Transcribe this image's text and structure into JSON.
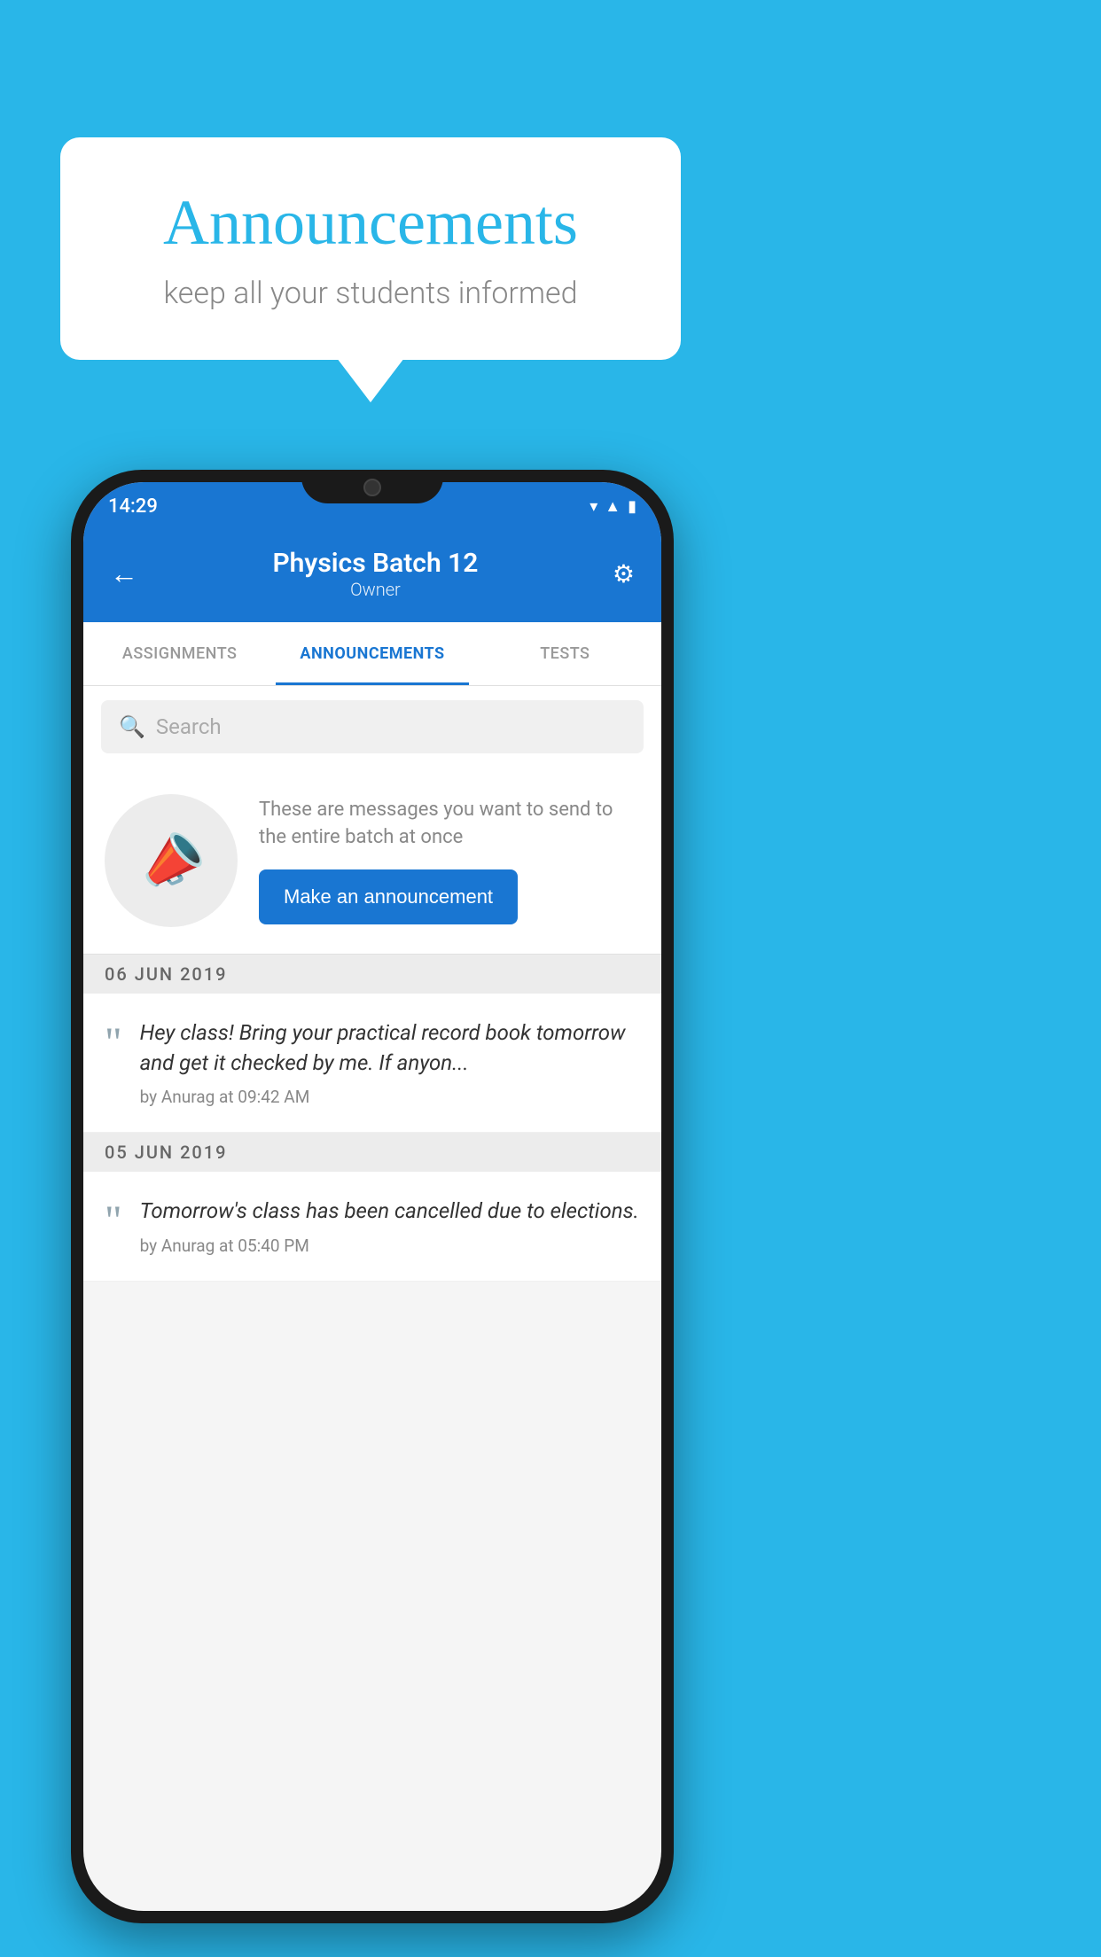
{
  "background_color": "#29b6e8",
  "speech_bubble": {
    "title": "Announcements",
    "subtitle": "keep all your students informed"
  },
  "status_bar": {
    "time": "14:29",
    "icons": [
      "wifi",
      "signal",
      "battery"
    ]
  },
  "header": {
    "title": "Physics Batch 12",
    "subtitle": "Owner",
    "back_label": "←",
    "gear_label": "⚙"
  },
  "tabs": [
    {
      "label": "ASSIGNMENTS",
      "active": false
    },
    {
      "label": "ANNOUNCEMENTS",
      "active": true
    },
    {
      "label": "TESTS",
      "active": false
    },
    {
      "label": "...",
      "active": false
    }
  ],
  "search": {
    "placeholder": "Search"
  },
  "announcement_prompt": {
    "description": "These are messages you want to send to the entire batch at once",
    "button_label": "Make an announcement"
  },
  "date_sections": [
    {
      "date": "06  JUN  2019",
      "items": [
        {
          "message": "Hey class! Bring your practical record book tomorrow and get it checked by me. If anyon...",
          "meta": "by Anurag at 09:42 AM"
        }
      ]
    },
    {
      "date": "05  JUN  2019",
      "items": [
        {
          "message": "Tomorrow's class has been cancelled due to elections.",
          "meta": "by Anurag at 05:40 PM"
        }
      ]
    }
  ]
}
